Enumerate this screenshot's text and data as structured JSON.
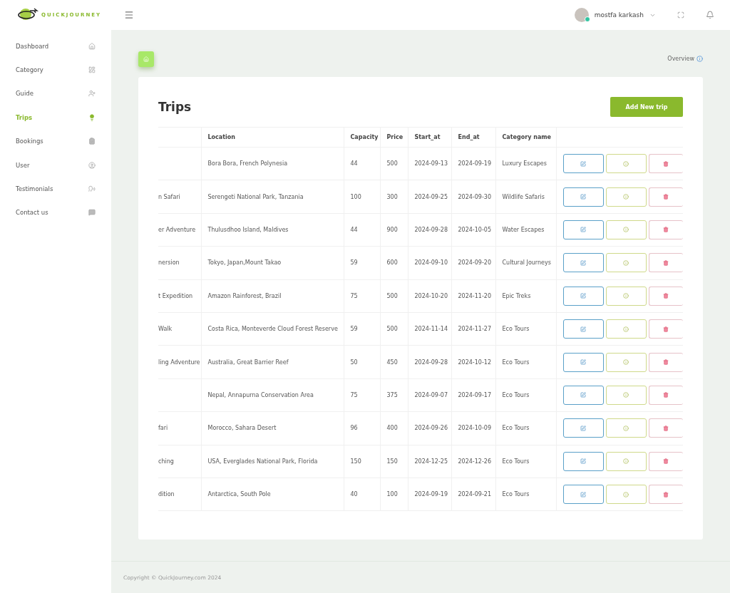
{
  "brand": {
    "name": "QUICKJOURNEY"
  },
  "sidebar": {
    "items": [
      {
        "label": "Dashboard",
        "selected": false
      },
      {
        "label": "Category",
        "selected": false
      },
      {
        "label": "Guide",
        "selected": false
      },
      {
        "label": "Trips",
        "selected": true
      },
      {
        "label": "Bookings",
        "selected": false
      },
      {
        "label": "User",
        "selected": false
      },
      {
        "label": "Testimonials",
        "selected": false
      },
      {
        "label": "Contact us",
        "selected": false
      }
    ]
  },
  "header": {
    "user_name": "mostfa karkash",
    "online": true
  },
  "breadcrumb": {
    "label": "Overview"
  },
  "page": {
    "title": "Trips",
    "add_button": "Add New trip"
  },
  "table": {
    "columns": [
      "",
      "Location",
      "Capacity",
      "Price",
      "Start_at",
      "End_at",
      "Category name",
      ""
    ],
    "rows": [
      {
        "column_1": "",
        "location": "Bora Bora, French Polynesia",
        "capacity": "44",
        "price": "500",
        "start_at": "2024-09-13",
        "end_at": "2024-09-19",
        "category": "Luxury Escapes"
      },
      {
        "column_1": "n Safari",
        "location": "Serengeti National Park, Tanzania",
        "capacity": "100",
        "price": "300",
        "start_at": "2024-09-25",
        "end_at": "2024-09-30",
        "category": "Wildlife Safaris"
      },
      {
        "column_1": "er Adventure",
        "location": "Thulusdhoo Island, Maldives",
        "capacity": "44",
        "price": "900",
        "start_at": "2024-09-28",
        "end_at": "2024-10-05",
        "category": "Water Escapes"
      },
      {
        "column_1": "nersion",
        "location": "Tokyo, Japan,Mount Takao",
        "capacity": "59",
        "price": "600",
        "start_at": "2024-09-10",
        "end_at": "2024-09-20",
        "category": "Cultural Journeys"
      },
      {
        "column_1": "t Expedition",
        "location": "Amazon Rainforest, Brazil",
        "capacity": "75",
        "price": "500",
        "start_at": "2024-10-20",
        "end_at": "2024-11-20",
        "category": "Epic Treks"
      },
      {
        "column_1": "Walk",
        "location": "Costa Rica, Monteverde Cloud Forest Reserve",
        "capacity": "59",
        "price": "500",
        "start_at": "2024-11-14",
        "end_at": "2024-11-27",
        "category": "Eco Tours"
      },
      {
        "column_1": "ling Adventure",
        "location": "Australia, Great Barrier Reef",
        "capacity": "50",
        "price": "450",
        "start_at": "2024-09-28",
        "end_at": "2024-10-12",
        "category": "Eco Tours"
      },
      {
        "column_1": "",
        "location": "Nepal, Annapurna Conservation Area",
        "capacity": "75",
        "price": "375",
        "start_at": "2024-09-07",
        "end_at": "2024-09-17",
        "category": "Eco Tours"
      },
      {
        "column_1": "fari",
        "location": "Morocco, Sahara Desert",
        "capacity": "96",
        "price": "400",
        "start_at": "2024-09-26",
        "end_at": "2024-10-09",
        "category": "Eco Tours"
      },
      {
        "column_1": "ching",
        "location": "USA, Everglades National Park, Florida",
        "capacity": "150",
        "price": "150",
        "start_at": "2024-12-25",
        "end_at": "2024-12-26",
        "category": "Eco Tours"
      },
      {
        "column_1": "dition",
        "location": "Antarctica, South Pole",
        "capacity": "40",
        "price": "100",
        "start_at": "2024-09-19",
        "end_at": "2024-09-21",
        "category": "Eco Tours"
      }
    ]
  },
  "footer": {
    "text": "Copyright © QuickJourney.com 2024"
  }
}
